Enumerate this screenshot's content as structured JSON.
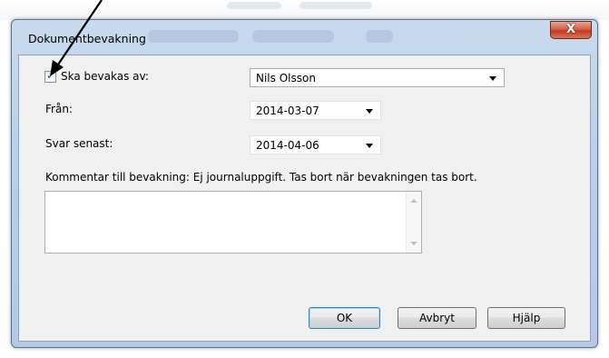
{
  "window": {
    "title": "Dokumentbevakning",
    "close_label": "X"
  },
  "form": {
    "watch_checkbox": {
      "checked": true,
      "label": "Ska bevakas av:"
    },
    "watcher": {
      "value": "Nils Olsson"
    },
    "from": {
      "label": "Från:",
      "value": "2014-03-07"
    },
    "reply_by": {
      "label": "Svar senast:",
      "value": "2014-04-06"
    },
    "comment": {
      "label": "Kommentar till bevakning: Ej journaluppgift. Tas bort när bevakningen tas bort.",
      "value": ""
    }
  },
  "buttons": {
    "ok": "OK",
    "cancel": "Avbryt",
    "help": "Hjälp"
  },
  "icons": {
    "check": "✓",
    "annotation": "arrow-pointer-icon"
  },
  "colors": {
    "frame": "#b3c9e6",
    "client": "#f0f0f0",
    "close": "#c23b22",
    "default_button_border": "#3c7fb1"
  }
}
